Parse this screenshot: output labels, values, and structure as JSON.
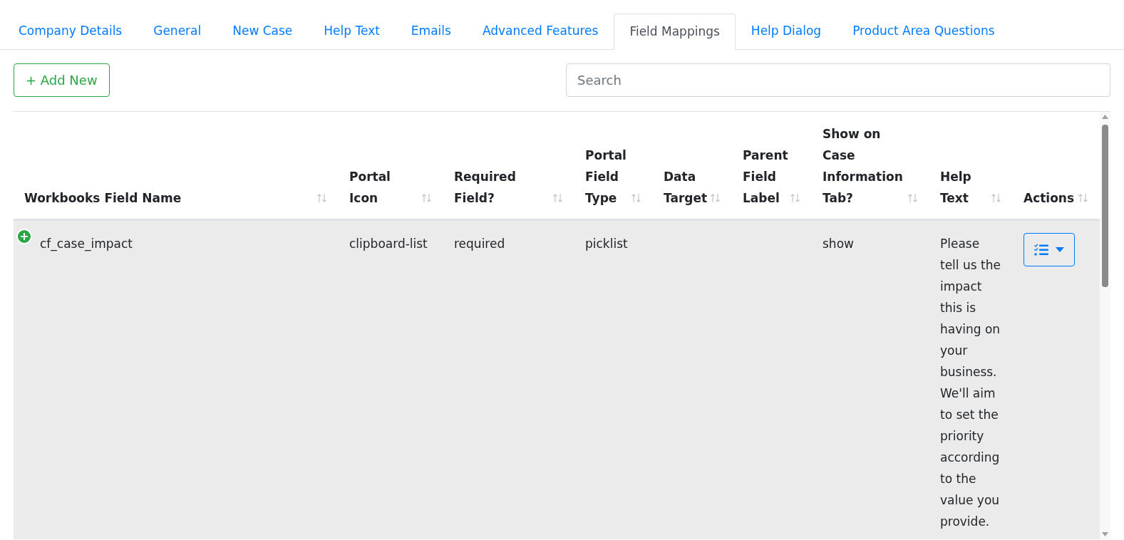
{
  "tabs": [
    {
      "label": "Company Details",
      "selected": false
    },
    {
      "label": "General",
      "selected": false
    },
    {
      "label": "New Case",
      "selected": false
    },
    {
      "label": "Help Text",
      "selected": false
    },
    {
      "label": "Emails",
      "selected": false
    },
    {
      "label": "Advanced Features",
      "selected": false
    },
    {
      "label": "Field Mappings",
      "selected": true
    },
    {
      "label": "Help Dialog",
      "selected": false
    },
    {
      "label": "Product Area Questions",
      "selected": false
    }
  ],
  "toolbar": {
    "add_button": "+ Add New",
    "search": {
      "placeholder": "Search"
    }
  },
  "table": {
    "columns": [
      "Workbooks Field Name",
      "Portal Icon",
      "Required Field?",
      "Portal Field Type",
      "Data Target",
      "Parent Field Label",
      "Show on Case Information Tab?",
      "Help Text",
      "Actions"
    ],
    "rows": [
      {
        "cells": [
          "cf_case_impact",
          "clipboard-list",
          "required",
          "picklist",
          "",
          "",
          "show",
          "Please tell us the impact this is having on your business. We'll aim to set the priority according to the value you provide."
        ]
      }
    ]
  }
}
